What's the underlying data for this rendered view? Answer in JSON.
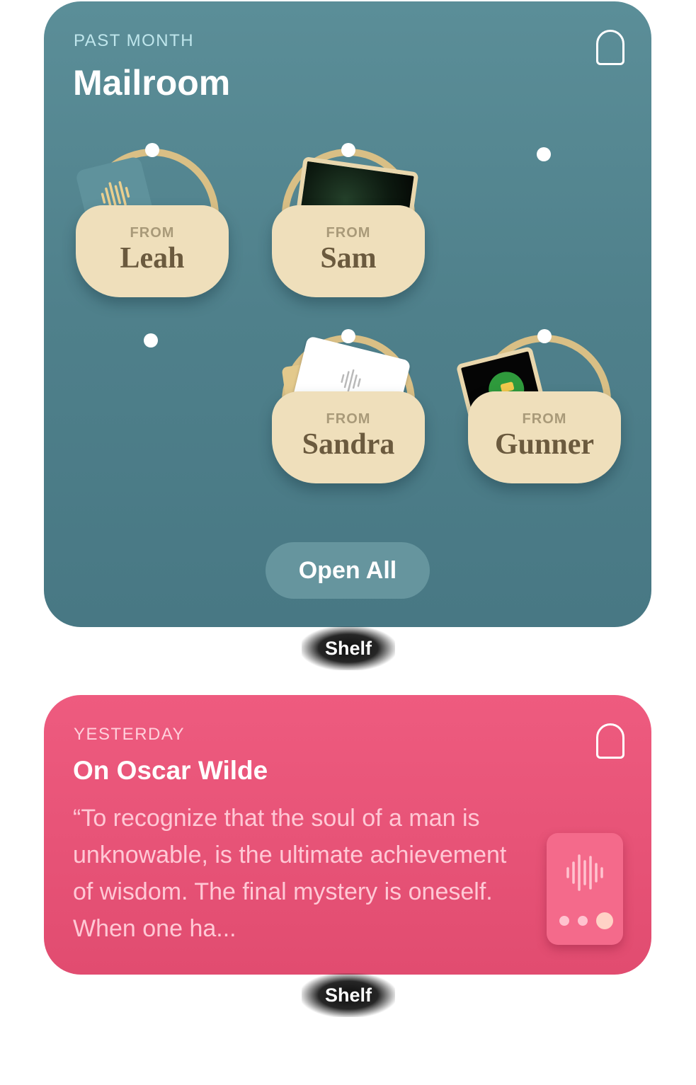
{
  "mailroom": {
    "eyebrow": "PAST MONTH",
    "title": "Mailroom",
    "baskets": [
      {
        "from_label": "FROM",
        "name": "Leah",
        "item": "audio-card-icon"
      },
      {
        "from_label": "FROM",
        "name": "Sam",
        "item": "photo-icon"
      },
      {
        "from_label": "FROM",
        "name": "Sandra",
        "item": "letter-envelope-icon"
      },
      {
        "from_label": "FROM",
        "name": "Gunner",
        "item": "photo-icon"
      }
    ],
    "open_all_label": "Open All",
    "shelf_label": "Shelf",
    "colors": {
      "background": "#538590",
      "basket": "#efdfbb",
      "handle": "#d9bf85"
    }
  },
  "quote_card": {
    "eyebrow": "YESTERDAY",
    "title": "On Oscar Wilde",
    "excerpt": "“To recognize that the soul of a man is unknowable, is the ultimate achievement of wisdom. The final mystery is oneself. When one ha...",
    "shelf_label": "Shelf",
    "colors": {
      "background": "#e8557a",
      "device": "#f46a8b"
    }
  }
}
